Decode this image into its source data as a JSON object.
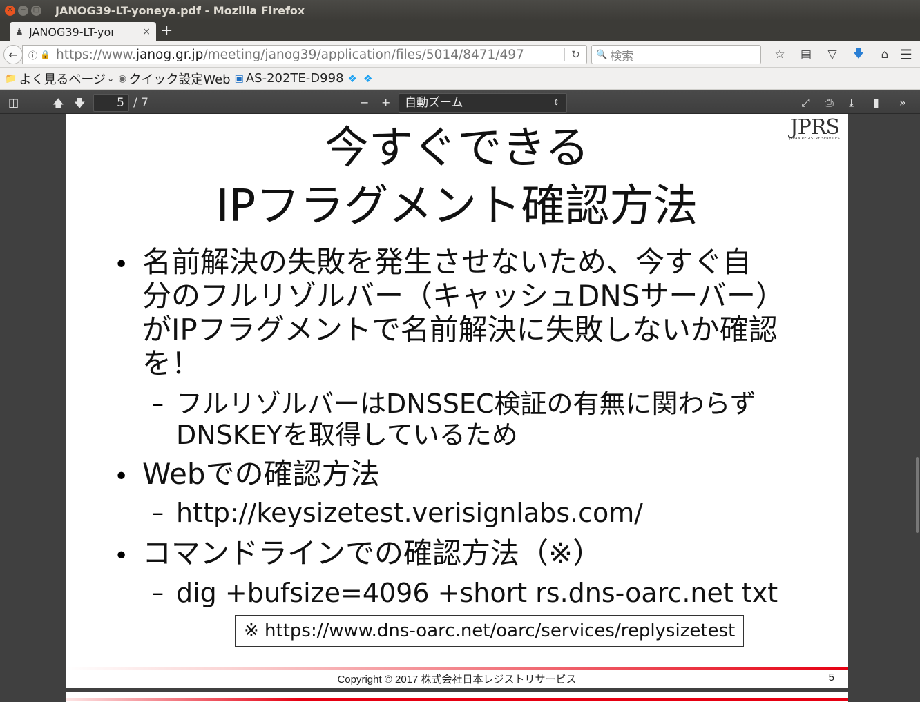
{
  "window": {
    "title": "JANOG39-LT-yoneya.pdf - Mozilla Firefox",
    "close_glyph": "✕",
    "min_glyph": "−",
    "max_glyph": "□"
  },
  "tabs": [
    {
      "label": "JANOG39-LT-yoı",
      "close_glyph": "×",
      "icon": "pdf-icon"
    }
  ],
  "newtab_glyph": "+",
  "nav": {
    "back_glyph": "←",
    "url_prefix": "https://www.",
    "url_host": "janog.gr.jp",
    "url_path": "/meeting/janog39/application/files/5014/8471/497",
    "reload_glyph": "↻",
    "search_placeholder": "検索",
    "icons": [
      "star-icon",
      "library-icon",
      "pocket-icon",
      "download-icon",
      "home-icon",
      "menu-icon"
    ]
  },
  "bookmarks": [
    {
      "label": "よく見るページ",
      "icon": "folder-icon",
      "has_chevron": true
    },
    {
      "label": "クイック設定Web",
      "icon": "globe-icon"
    },
    {
      "label": "AS-202TE-D998",
      "icon": "as-icon"
    },
    {
      "label": "",
      "icon": "twitter-icon"
    },
    {
      "label": "",
      "icon": "twitter-icon"
    }
  ],
  "pdf_toolbar": {
    "current_page": "5",
    "total_pages": "/ 7",
    "zoom_minus": "−",
    "zoom_plus": "+",
    "zoom_value": "自動ズーム"
  },
  "slide": {
    "logo_text": "JPRS",
    "logo_sub": "JAPAN REGISTRY SERVICES",
    "title_line1": "今すぐできる",
    "title_line2": "IPフラグメント確認方法",
    "bullet1_lines": [
      "名前解決の失敗を発生させないため、今すぐ自",
      "分のフルリゾルバー（キャッシュDNSサーバー）",
      "がIPフラグメントで名前解決に失敗しないか確認",
      "を！"
    ],
    "sub1_lines": [
      "フルリゾルバーはDNSSEC検証の有無に関わらず",
      "DNSKEYを取得しているため"
    ],
    "bullet2": "Webでの確認方法",
    "sub2": "http://keysizetest.verisignlabs.com/",
    "bullet3": "コマンドラインでの確認方法（※）",
    "sub3": "dig +bufsize=4096 +short rs.dns-oarc.net txt",
    "ref": "※ https://www.dns-oarc.net/oarc/services/replysizetest",
    "copyright": "Copyright © 2017 株式会社日本レジストリサービス",
    "page_number": "5",
    "bullet_glyph": "•",
    "dash_glyph": "–"
  },
  "colors": {
    "brand_red": "#e60012",
    "ubuntu_orange": "#e95420"
  }
}
